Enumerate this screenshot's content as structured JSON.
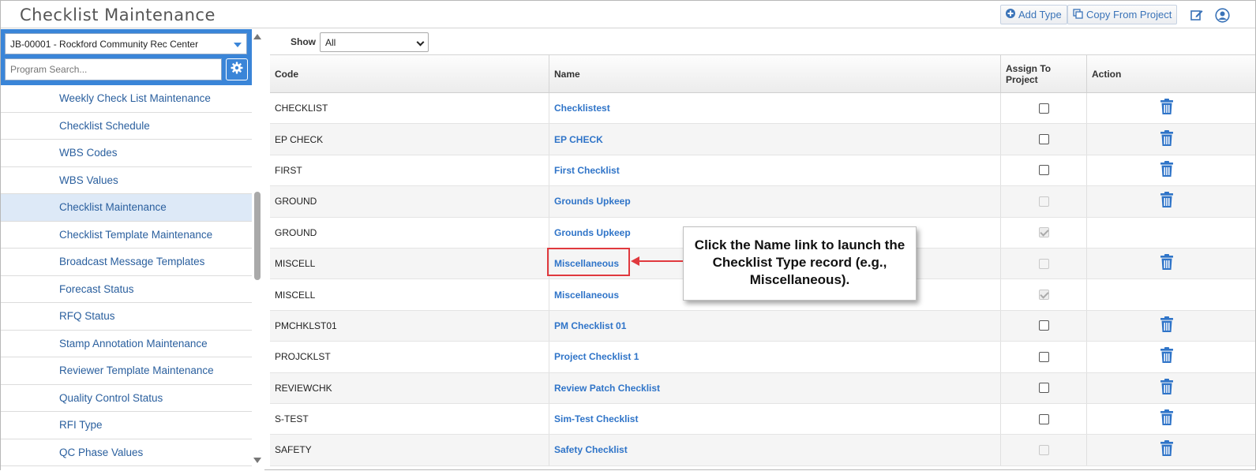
{
  "app": {
    "title": "Checklist Maintenance"
  },
  "header": {
    "add_type_label": "Add Type",
    "copy_from_project_label": "Copy From Project"
  },
  "sidebar": {
    "project_value": "JB-00001 - Rockford Community Rec Center",
    "search_placeholder": "Program Search...",
    "items": [
      {
        "label": "Weekly Check List Maintenance"
      },
      {
        "label": "Checklist Schedule"
      },
      {
        "label": "WBS Codes"
      },
      {
        "label": "WBS Values"
      },
      {
        "label": "Checklist Maintenance",
        "active": true
      },
      {
        "label": "Checklist Template Maintenance"
      },
      {
        "label": "Broadcast Message Templates"
      },
      {
        "label": "Forecast Status"
      },
      {
        "label": "RFQ Status"
      },
      {
        "label": "Stamp Annotation Maintenance"
      },
      {
        "label": "Reviewer Template Maintenance"
      },
      {
        "label": "Quality Control Status"
      },
      {
        "label": "RFI Type"
      },
      {
        "label": "QC Phase Values"
      }
    ]
  },
  "filter": {
    "show_label": "Show",
    "show_value": "All"
  },
  "table": {
    "columns": {
      "code": "Code",
      "name": "Name",
      "assign": "Assign To Project",
      "action": "Action"
    },
    "rows": [
      {
        "code": "CHECKLIST",
        "name": "Checklistest",
        "assign": "unchecked",
        "delete": true
      },
      {
        "code": "EP CHECK",
        "name": "EP CHECK",
        "assign": "unchecked",
        "delete": true
      },
      {
        "code": "FIRST",
        "name": "First Checklist",
        "assign": "unchecked",
        "delete": true
      },
      {
        "code": "GROUND",
        "name": "Grounds Upkeep",
        "assign": "disabled",
        "delete": true
      },
      {
        "code": "GROUND",
        "name": "Grounds Upkeep",
        "assign": "checked-disabled",
        "delete": false
      },
      {
        "code": "MISCELL",
        "name": "Miscellaneous",
        "assign": "disabled",
        "delete": true
      },
      {
        "code": "MISCELL",
        "name": "Miscellaneous",
        "assign": "checked-disabled",
        "delete": false
      },
      {
        "code": "PMCHKLST01",
        "name": "PM Checklist 01",
        "assign": "unchecked",
        "delete": true
      },
      {
        "code": "PROJCKLST",
        "name": "Project Checklist 1",
        "assign": "unchecked",
        "delete": true
      },
      {
        "code": "REVIEWCHK",
        "name": "Review Patch Checklist",
        "assign": "unchecked",
        "delete": true
      },
      {
        "code": "S-TEST",
        "name": "Sim-Test Checklist",
        "assign": "unchecked",
        "delete": true
      },
      {
        "code": "SAFETY",
        "name": "Safety Checklist",
        "assign": "disabled",
        "delete": true
      }
    ]
  },
  "callout": {
    "text": "Click the Name link to launch the Checklist Type record (e.g., Miscellaneous)."
  },
  "colors": {
    "accent": "#3a85d8",
    "link": "#2f74c8",
    "highlight": "#e0393e"
  },
  "icons": [
    "plus-circle-icon",
    "copy-icon",
    "edit-icon",
    "user-circle-icon",
    "gear-icon",
    "trash-icon",
    "chevron-down-icon"
  ]
}
